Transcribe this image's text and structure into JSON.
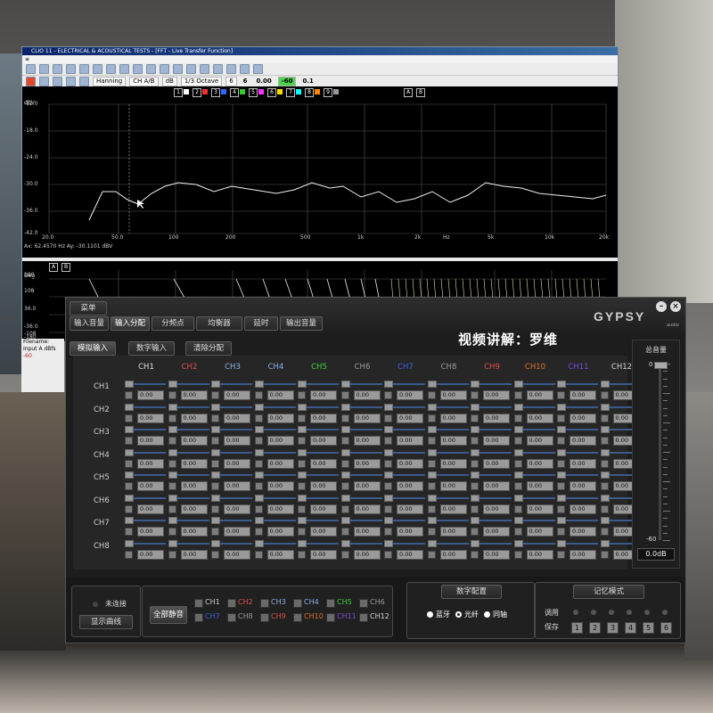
{
  "clio": {
    "title": "CLIO 11 - ELECTRICAL & ACOUSTICAL TESTS - [FFT - Live Transfer Function]",
    "toolbar": {
      "window": "Hanning",
      "channel": "CH A/B",
      "unit": "dB",
      "smoothing": "1/3 Octave",
      "v1": "6",
      "v2": "6",
      "v3": "0.00",
      "level": "-60",
      "v4": "0.1"
    },
    "plot1": {
      "y_unit": "dBV",
      "y_ticks": [
        "-12.0",
        "-18.0",
        "-24.0",
        "-30.0",
        "-36.0",
        "-42.0"
      ],
      "x_ticks": [
        "20.0",
        "50.0",
        "100",
        "200",
        "500",
        "1k",
        "2k",
        "Hz",
        "5k",
        "10k",
        "20k"
      ],
      "cursor_readout": "Ax: 62.4570 Hz  Ay: -30.1101 dBV",
      "markers": [
        "1",
        "2",
        "3",
        "4",
        "5",
        "6",
        "7",
        "8",
        "9",
        "A",
        "B"
      ]
    },
    "plot2": {
      "y_unit": "Deg",
      "y_ticks": [
        "180",
        "108",
        "36.0",
        "-36.0",
        "-108",
        "-180"
      ],
      "markers": [
        "A",
        "B"
      ]
    },
    "side": {
      "filename": "Filename:",
      "input": "Input A",
      "input_unit": "dBfs",
      "value": "-60"
    }
  },
  "gypsy": {
    "menu_button": "菜单",
    "tabs": [
      "输入音量",
      "输入分配",
      "分频点",
      "均衡器",
      "延时",
      "输出音量"
    ],
    "active_tab": 1,
    "subtabs": [
      "模拟输入",
      "数字输入",
      "清除分配"
    ],
    "active_subtab": 0,
    "watermark": "视频讲解：罗维",
    "logo": "GYPSY",
    "logo_sub": "audio",
    "columns": [
      "CH1",
      "CH2",
      "CH3",
      "CH4",
      "CH5",
      "CH6",
      "CH7",
      "CH8",
      "CH9",
      "CH10",
      "CH11",
      "CH12"
    ],
    "column_colors": [
      "#e0e0e0",
      "#e05050",
      "#8fb0e8",
      "#8fb0e8",
      "#40d040",
      "#9a9a9a",
      "#3b5fe0",
      "#9a9a9a",
      "#e05050",
      "#e07030",
      "#7a4fe0",
      "#d8d8d8"
    ],
    "rows": [
      "CH1",
      "CH2",
      "CH3",
      "CH4",
      "CH5",
      "CH6",
      "CH7",
      "CH8"
    ],
    "cell_value": "0.00",
    "master": {
      "label": "总音量",
      "top_tick": "0",
      "bottom_tick": "-60",
      "value": "0.0dB"
    },
    "status": {
      "connection": "未连接",
      "show_curve": "显示曲线"
    },
    "mute": {
      "all_mute": "全部静音",
      "channels": [
        "CH1",
        "CH2",
        "CH3",
        "CH4",
        "CH5",
        "CH6",
        "CH7",
        "CH8",
        "CH9",
        "CH10",
        "CH11",
        "CH12"
      ],
      "colors": [
        "#cfcfcf",
        "#e05050",
        "#8fb0e8",
        "#8fb0e8",
        "#40d040",
        "#9a9a9a",
        "#3b5fe0",
        "#9a9a9a",
        "#e05050",
        "#e07030",
        "#7a4fe0",
        "#d8d8d8"
      ]
    },
    "digital": {
      "title": "数字配置",
      "options": [
        "蓝牙",
        "光纤",
        "同轴"
      ],
      "selected": 1
    },
    "memory": {
      "title": "记忆模式",
      "recall": "调用",
      "save": "保存",
      "slots": [
        "1",
        "2",
        "3",
        "4",
        "5",
        "6"
      ]
    }
  }
}
